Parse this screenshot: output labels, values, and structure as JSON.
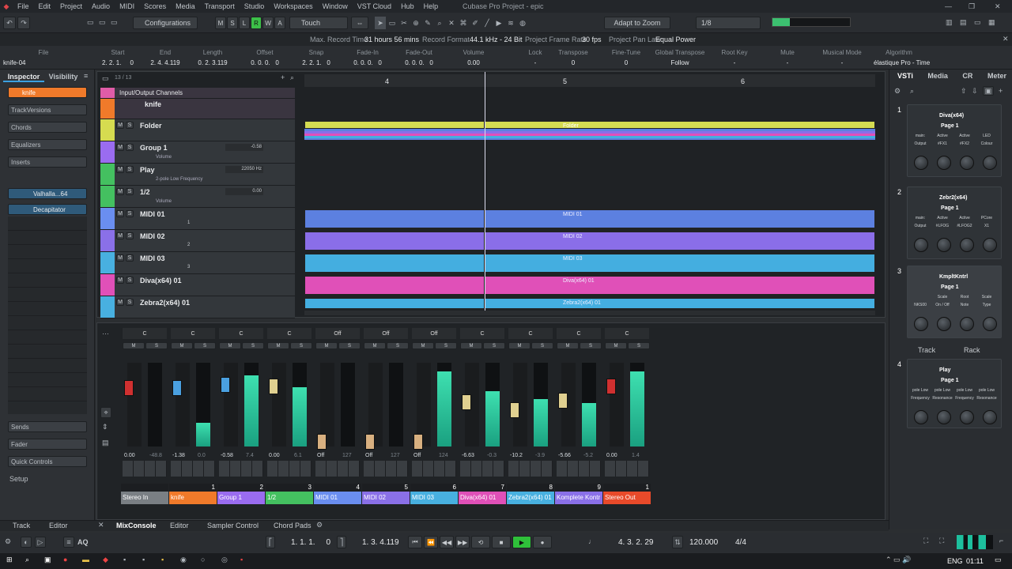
{
  "window": {
    "title": "Cubase Pro Project - epic"
  },
  "menu": [
    "File",
    "Edit",
    "Project",
    "Audio",
    "MIDI",
    "Scores",
    "Media",
    "Transport",
    "Studio",
    "Workspaces",
    "Window",
    "VST Cloud",
    "Hub",
    "Help"
  ],
  "toolbar": {
    "configurations": "Configurations",
    "mode_letters": [
      "M",
      "S",
      "L",
      "R",
      "W",
      "A"
    ],
    "touch": "Touch",
    "snap_mode": "Adapt to Zoom",
    "quantize": "1/8"
  },
  "status": {
    "max_record_label": "Max. Record Time",
    "max_record_value": "31 hours 56 mins",
    "record_format_label": "Record Format",
    "record_format_value": "44.1 kHz - 24 Bit",
    "frame_rate_label": "Project Frame Rate",
    "frame_rate_value": "30 fps",
    "pan_law_label": "Project Pan Law",
    "pan_law_value": "Equal Power"
  },
  "infoline": {
    "file_label": "File",
    "file_value": "knife-04",
    "fields": [
      {
        "h": "Start",
        "v": "2. 2. 1.     0"
      },
      {
        "h": "End",
        "v": "2. 4. 4.119"
      },
      {
        "h": "Length",
        "v": "0. 2. 3.119"
      },
      {
        "h": "Offset",
        "v": "0. 0. 0.   0"
      },
      {
        "h": "Snap",
        "v": "2. 2. 1.   0"
      },
      {
        "h": "Fade-In",
        "v": "0. 0. 0.   0"
      },
      {
        "h": "Fade-Out",
        "v": "0. 0. 0.   0"
      },
      {
        "h": "Volume",
        "v": "0.00"
      },
      {
        "h": "Lock",
        "v": "-"
      },
      {
        "h": "Transpose",
        "v": "0"
      },
      {
        "h": "Fine-Tune",
        "v": "0"
      },
      {
        "h": "Global Transpose",
        "v": "Follow"
      },
      {
        "h": "Root Key",
        "v": "-"
      },
      {
        "h": "Mute",
        "v": "-"
      },
      {
        "h": "Musical Mode",
        "v": "-"
      },
      {
        "h": "Algorithm",
        "v": "élastique Pro - Time"
      }
    ],
    "db": "dB"
  },
  "inspector": {
    "tabs": [
      "Inspector",
      "Visibility"
    ],
    "track_name": "knife",
    "sections": [
      "TrackVersions",
      "Chords",
      "Equalizers",
      "Inserts"
    ],
    "inserts": [
      "Valhalla...64",
      "Decapitator"
    ],
    "bottom_sections": [
      "Sends",
      "Fader",
      "Quick Controls"
    ],
    "setup": "Setup"
  },
  "project": {
    "count": "13 / 13",
    "ruler": [
      "4",
      "5",
      "6"
    ],
    "tracks": [
      {
        "name": "Input/Output Channels",
        "color": "#e05ca8"
      },
      {
        "name": "knife",
        "color": "#f07a2a"
      },
      {
        "name": "Folder",
        "color": "#d6dc50"
      },
      {
        "name": "Group 1",
        "color": "#9a6cf0",
        "value": "-0.58",
        "sub": "Volume"
      },
      {
        "name": "Play",
        "color": "#44c060",
        "sub": "2-pole Low Frequency",
        "value": "22050 Hz"
      },
      {
        "name": "1/2",
        "color": "#44c060",
        "value": "0.00",
        "sub": "Volume"
      },
      {
        "name": "MIDI 01",
        "color": "#6a8ef0",
        "num": "1"
      },
      {
        "name": "MIDI 02",
        "color": "#8a70e8",
        "num": "2"
      },
      {
        "name": "MIDI 03",
        "color": "#48b0e0",
        "num": "3"
      },
      {
        "name": "Diva(x64) 01",
        "color": "#e050b8"
      },
      {
        "name": "Zebra2(x64) 01",
        "color": "#48b0e0"
      }
    ],
    "events": {
      "folder": "Folder",
      "midi01": "MIDI 01",
      "midi02": "MIDI 02",
      "midi03": "MIDI 03",
      "diva": "Diva(x64) 01",
      "zebra": "Zebra2(x64) 01"
    }
  },
  "mixer": {
    "channels": [
      {
        "name": "Stereo In",
        "num": "",
        "color": "#7a7f84",
        "pan": "C",
        "fader": "0.00",
        "peak": "-48.8"
      },
      {
        "name": "knife",
        "num": "1",
        "color": "#f07a2a",
        "pan": "C",
        "fader": "-1.38",
        "peak": "0.0"
      },
      {
        "name": "Group 1",
        "num": "2",
        "color": "#9a6cf0",
        "pan": "C",
        "fader": "-0.58",
        "peak": "7.4"
      },
      {
        "name": "1/2",
        "num": "3",
        "color": "#44c060",
        "pan": "C",
        "fader": "0.00",
        "peak": "6.1"
      },
      {
        "name": "MIDI 01",
        "num": "4",
        "color": "#6a8ef0",
        "pan": "Off",
        "fader": "Off",
        "peak": "127"
      },
      {
        "name": "MIDI 02",
        "num": "5",
        "color": "#8a70e8",
        "pan": "Off",
        "fader": "Off",
        "peak": "127"
      },
      {
        "name": "MIDI 03",
        "num": "6",
        "color": "#48b0e0",
        "pan": "Off",
        "fader": "Off",
        "peak": "124"
      },
      {
        "name": "Diva(x64) 01",
        "num": "7",
        "color": "#e050b8",
        "pan": "C",
        "fader": "-6.63",
        "peak": "-0.3"
      },
      {
        "name": "Zebra2(x64) 01",
        "num": "8",
        "color": "#48b0e0",
        "pan": "C",
        "fader": "-10.2",
        "peak": "-3.9"
      },
      {
        "name": "Komplete Kontr",
        "num": "9",
        "color": "#8a70e8",
        "pan": "C",
        "fader": "-5.66",
        "peak": "-5.2"
      },
      {
        "name": "Stereo Out",
        "num": "1",
        "color": "#e84a2a",
        "pan": "C",
        "fader": "0.00",
        "peak": "1.4"
      }
    ]
  },
  "right": {
    "tabs": [
      "VSTi",
      "Media",
      "CR",
      "Meter"
    ],
    "instruments": [
      {
        "slot": "1",
        "name": "Diva(x64)",
        "page": "Page 1",
        "params": [
          "main:",
          "Active",
          "Active",
          "LED"
        ],
        "params2": [
          "Output",
          "#FX1",
          "#FX2",
          "Colour"
        ]
      },
      {
        "slot": "2",
        "name": "Zebr2(x64)",
        "page": "Page 1",
        "params": [
          "main:",
          "Active",
          "Active",
          "PCore"
        ],
        "params2": [
          "Output",
          "#LFOG",
          "#LFOG2",
          "X1"
        ]
      },
      {
        "slot": "3",
        "name": "KmpltKntrl",
        "page": "Page 1",
        "params": [
          "",
          "Scale",
          "Root",
          "Scale"
        ],
        "params2": [
          "NKS00",
          "On / Off",
          "Note",
          "Type"
        ]
      },
      {
        "slot": "4",
        "name": "Play",
        "page": "Page 1",
        "params": [
          "pole Low",
          "pole Low",
          "pole Low",
          "pole Low"
        ],
        "params2": [
          "Frequency",
          "Resonance",
          "Frequency",
          "Resonance"
        ]
      }
    ],
    "track_label": "Track",
    "rack_label": "Rack"
  },
  "bottom_tabs": {
    "left": [
      "Track",
      "Editor"
    ],
    "main": [
      "MixConsole",
      "Editor",
      "Sampler Control",
      "Chord Pads"
    ]
  },
  "transport": {
    "left_locator": "1. 1. 1.     0",
    "right_locator": "1. 3. 4.119",
    "position": "4. 3. 2. 29",
    "tempo": "120.000",
    "signature": "4/4"
  },
  "taskbar": {
    "lang": "ENG",
    "time": "01:11"
  }
}
